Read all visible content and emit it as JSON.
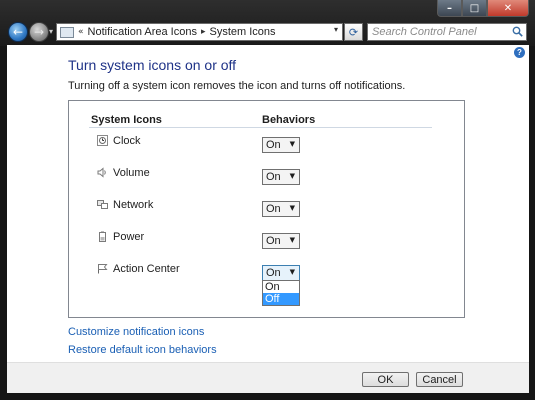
{
  "window": {
    "caption_buttons": {
      "minimize": "–",
      "maximize": "□",
      "close": "✕"
    }
  },
  "nav": {
    "back_glyph": "←",
    "forward_glyph": "→",
    "dropdown_glyph": "▾",
    "breadcrumb": [
      "Notification Area Icons",
      "System Icons"
    ],
    "breadcrumb_separator": "▸",
    "history_glyph": "«",
    "refresh_glyph": "⟳",
    "search_placeholder": "Search Control Panel"
  },
  "main": {
    "title": "Turn system icons on or off",
    "description": "Turning off a system icon removes the icon and turns off notifications.",
    "columns": {
      "icons": "System Icons",
      "behaviors": "Behaviors"
    },
    "rows": [
      {
        "label": "Clock",
        "value": "On",
        "icon": "clock-icon"
      },
      {
        "label": "Volume",
        "value": "On",
        "icon": "volume-icon"
      },
      {
        "label": "Network",
        "value": "On",
        "icon": "network-icon"
      },
      {
        "label": "Power",
        "value": "On",
        "icon": "power-icon"
      },
      {
        "label": "Action Center",
        "value": "On",
        "icon": "action-center-flag-icon"
      }
    ],
    "dropdown_options": [
      "On",
      "Off"
    ],
    "dropdown_highlighted": "Off",
    "links": {
      "customize": "Customize notification icons",
      "restore": "Restore default icon behaviors"
    }
  },
  "footer": {
    "ok_label": "OK",
    "cancel_label": "Cancel"
  },
  "colors": {
    "title_color": "#1e3287",
    "link_color": "#1a5fb4",
    "selection_color": "#3399ff"
  },
  "help_glyph": "?"
}
